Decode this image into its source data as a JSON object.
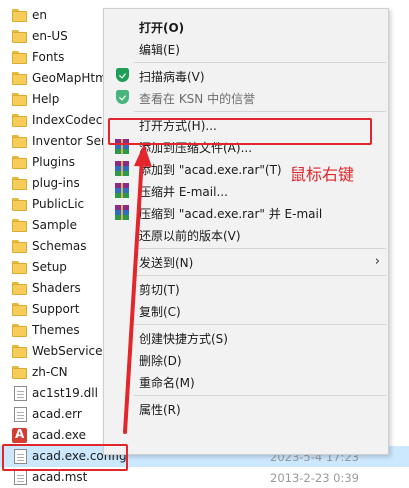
{
  "files": [
    {
      "name": "en",
      "type": "folder",
      "date": ""
    },
    {
      "name": "en-US",
      "type": "folder",
      "date": ""
    },
    {
      "name": "Fonts",
      "type": "folder",
      "date": ""
    },
    {
      "name": "GeoMapHtm",
      "type": "folder",
      "date": ""
    },
    {
      "name": "Help",
      "type": "folder",
      "date": ""
    },
    {
      "name": "IndexCodecs",
      "type": "folder",
      "date": ""
    },
    {
      "name": "Inventor Ser",
      "type": "folder",
      "date": ""
    },
    {
      "name": "Plugins",
      "type": "folder",
      "date": ""
    },
    {
      "name": "plug-ins",
      "type": "folder",
      "date": ""
    },
    {
      "name": "PublicLic",
      "type": "folder",
      "date": ""
    },
    {
      "name": "Sample",
      "type": "folder",
      "date": ""
    },
    {
      "name": "Schemas",
      "type": "folder",
      "date": ""
    },
    {
      "name": "Setup",
      "type": "folder",
      "date": ""
    },
    {
      "name": "Shaders",
      "type": "folder",
      "date": ""
    },
    {
      "name": "Support",
      "type": "folder",
      "date": ""
    },
    {
      "name": "Themes",
      "type": "folder",
      "date": ""
    },
    {
      "name": "WebServices",
      "type": "folder",
      "date": ""
    },
    {
      "name": "zh-CN",
      "type": "folder",
      "date": ""
    },
    {
      "name": "ac1st19.dll",
      "type": "doc",
      "date": ""
    },
    {
      "name": "acad.err",
      "type": "err",
      "date": ""
    },
    {
      "name": "acad.exe",
      "type": "acad",
      "date": ""
    },
    {
      "name": "acad.exe.config",
      "type": "doc",
      "date": "2023-5-4 17:23",
      "selected": true
    },
    {
      "name": "acad.mst",
      "type": "doc",
      "date": "2013-2-23 0:39"
    }
  ],
  "menu": {
    "items": [
      {
        "label": "打开(O)",
        "bold": true,
        "icon": ""
      },
      {
        "label": "编辑(E)",
        "icon": ""
      },
      {
        "sep": true
      },
      {
        "label": "扫描病毒(V)",
        "icon": "shield"
      },
      {
        "label": "查看在 KSN 中的信誉",
        "icon": "shield",
        "disabled": true
      },
      {
        "sep": true
      },
      {
        "label": "打开方式(H)...",
        "icon": ""
      },
      {
        "label": "添加到压缩文件(A)...",
        "icon": "winrar"
      },
      {
        "label": "添加到 \"acad.exe.rar\"(T)",
        "icon": "winrar"
      },
      {
        "label": "压缩并 E-mail...",
        "icon": "winrar"
      },
      {
        "label": "压缩到 \"acad.exe.rar\" 并 E-mail",
        "icon": "winrar"
      },
      {
        "label": "还原以前的版本(V)",
        "icon": ""
      },
      {
        "sep": true
      },
      {
        "label": "发送到(N)",
        "icon": "",
        "submenu": true
      },
      {
        "sep": true
      },
      {
        "label": "剪切(T)",
        "icon": ""
      },
      {
        "label": "复制(C)",
        "icon": ""
      },
      {
        "sep": true
      },
      {
        "label": "创建快捷方式(S)",
        "icon": ""
      },
      {
        "label": "删除(D)",
        "icon": ""
      },
      {
        "label": "重命名(M)",
        "icon": ""
      },
      {
        "sep": true
      },
      {
        "label": "属性(R)",
        "icon": ""
      }
    ]
  },
  "annotation": {
    "text": "鼠标右键",
    "color": "#e2262b"
  },
  "colors": {
    "selection": "#cce8ff",
    "menu_bg": "#f2f2f2",
    "annotation": "#e2262b"
  }
}
